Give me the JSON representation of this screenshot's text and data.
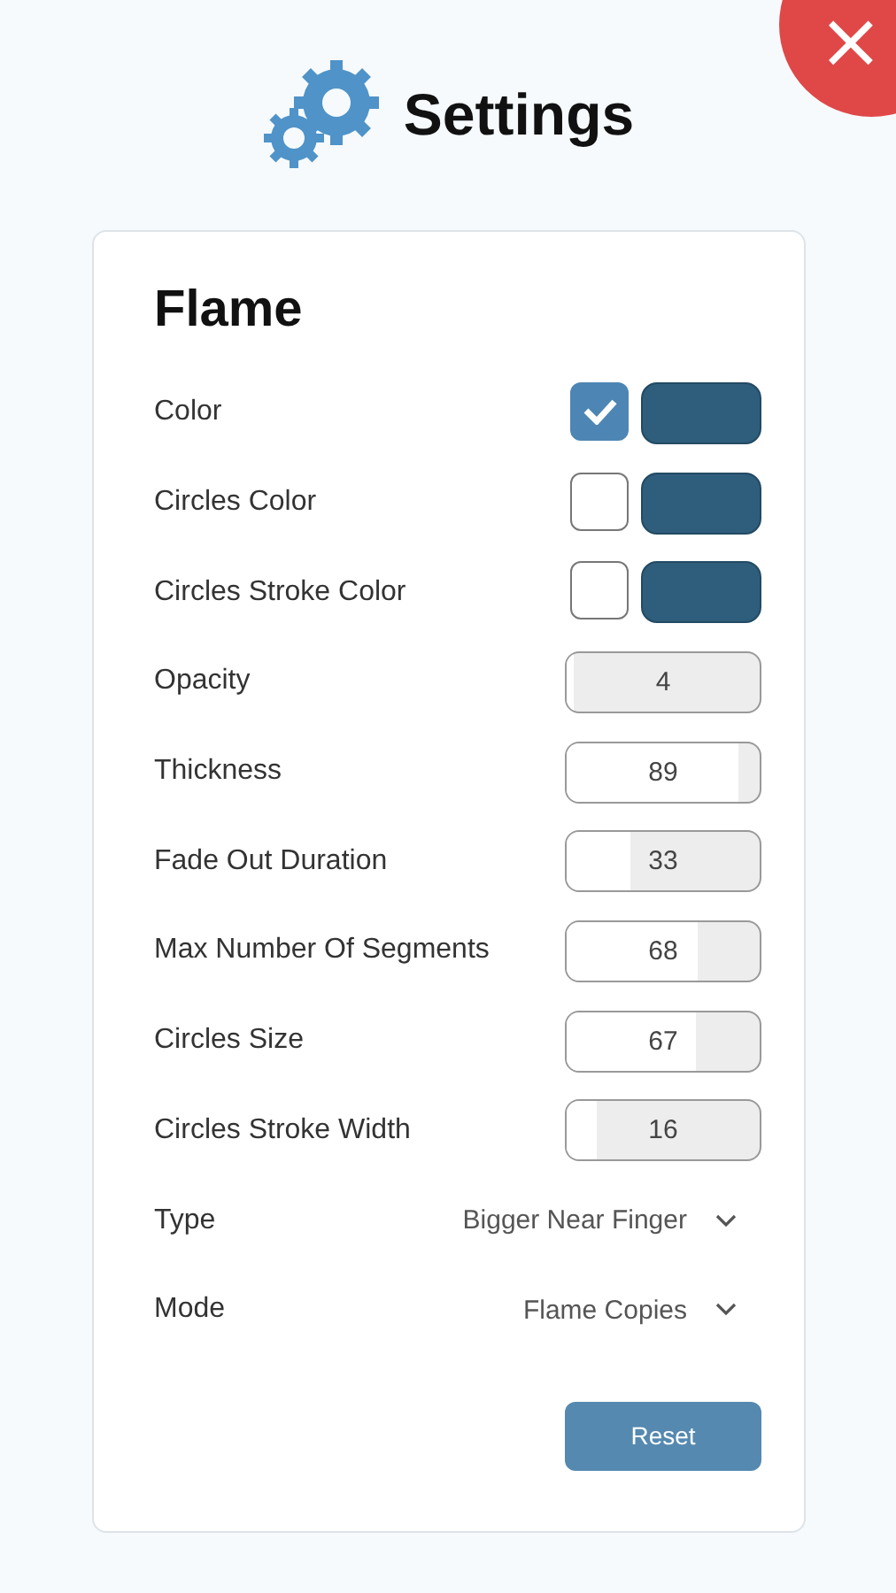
{
  "header": {
    "title": "Settings",
    "close": "×"
  },
  "card": {
    "title": "Flame",
    "rows": [
      {
        "kind": "color",
        "label": "Color",
        "checked": true
      },
      {
        "kind": "color",
        "label": "Circles Color",
        "checked": false
      },
      {
        "kind": "color",
        "label": "Circles Stroke Color",
        "checked": false
      },
      {
        "kind": "slider",
        "label": "Opacity",
        "value": "4",
        "level": 0.04
      },
      {
        "kind": "slider",
        "label": "Thickness",
        "value": "89",
        "level": 0.89
      },
      {
        "kind": "slider",
        "label": "Fade Out Duration",
        "value": "33",
        "level": 0.33
      },
      {
        "kind": "slider",
        "label": "Max Number Of Segments",
        "value": "68",
        "level": 0.68
      },
      {
        "kind": "slider",
        "label": "Circles Size",
        "value": "67",
        "level": 0.67
      },
      {
        "kind": "slider",
        "label": "Circles Stroke Width",
        "value": "16",
        "level": 0.16
      },
      {
        "kind": "select",
        "label": "Type",
        "value": "Bigger Near Finger"
      },
      {
        "kind": "select",
        "label": "Mode",
        "value": "Flame Copies"
      }
    ],
    "button": "Reset"
  }
}
